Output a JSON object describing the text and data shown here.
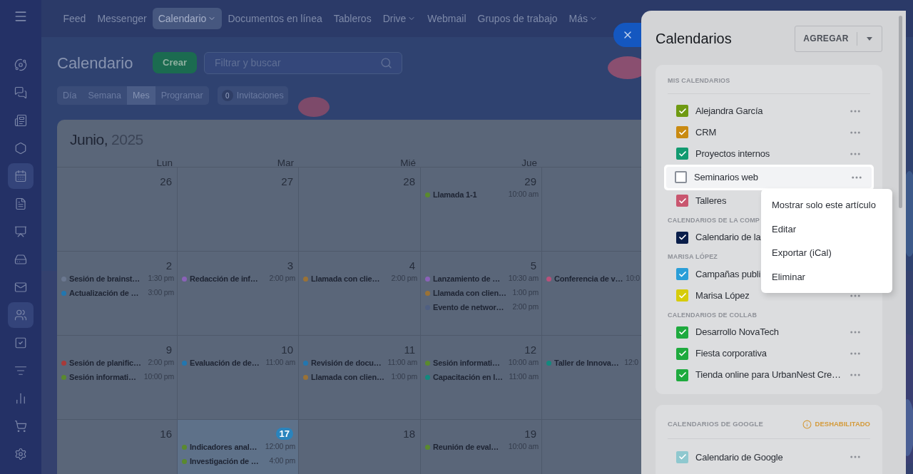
{
  "sidebar": {
    "items": [
      {
        "selected": false
      },
      {
        "selected": false
      },
      {
        "selected": false
      },
      {
        "selected": false
      },
      {
        "selected": true
      },
      {
        "selected": false
      },
      {
        "selected": false
      },
      {
        "selected": false
      },
      {
        "selected": false
      },
      {
        "selected": true
      },
      {
        "selected": false
      },
      {
        "selected": false
      },
      {
        "selected": false
      },
      {
        "selected": false
      },
      {
        "selected": false
      }
    ]
  },
  "top_nav": [
    {
      "label": "Feed",
      "selected": false,
      "dropdown": false
    },
    {
      "label": "Messenger",
      "selected": false,
      "dropdown": false
    },
    {
      "label": "Calendario",
      "selected": true,
      "dropdown": true
    },
    {
      "label": "Documentos en línea",
      "selected": false,
      "dropdown": false
    },
    {
      "label": "Tableros",
      "selected": false,
      "dropdown": false
    },
    {
      "label": "Drive",
      "selected": false,
      "dropdown": true
    },
    {
      "label": "Webmail",
      "selected": false,
      "dropdown": false
    },
    {
      "label": "Grupos de trabajo",
      "selected": false,
      "dropdown": false
    },
    {
      "label": "Más",
      "selected": false,
      "dropdown": true
    }
  ],
  "page_title": "Calendario",
  "create_button": "Crear",
  "search": {
    "placeholder": "Filtrar y buscar"
  },
  "view_tabs": [
    {
      "label": "Día",
      "selected": false
    },
    {
      "label": "Semana",
      "selected": false
    },
    {
      "label": "Mes",
      "selected": true
    },
    {
      "label": "Programar",
      "selected": false
    }
  ],
  "invitations": {
    "count": "0",
    "label": "Invitaciones"
  },
  "calendar": {
    "month": "Junio,",
    "year": "2025",
    "weekdays": [
      "Lun",
      "Mar",
      "Mié",
      "Jue"
    ],
    "weeks": [
      [
        {
          "day": "26",
          "today": false
        },
        {
          "day": "27",
          "today": false
        },
        {
          "day": "28",
          "today": false
        },
        {
          "day": "29",
          "today": false,
          "events": [
            {
              "title": "Llamada 1-1",
              "time": "10:00 am",
              "color": "#5a8a2e"
            }
          ]
        }
      ],
      [
        {
          "day": "2",
          "today": false,
          "events": [
            {
              "title": "Sesión de brainst…",
              "time": "1:30 pm",
              "color": "#6b7890"
            },
            {
              "title": "Actualización de …",
              "time": "3:00 pm",
              "color": "#2277b0"
            }
          ]
        },
        {
          "day": "3",
          "today": false,
          "events": [
            {
              "title": "Redacción de inf…",
              "time": "2:00 pm",
              "color": "#8a62b8"
            }
          ]
        },
        {
          "day": "4",
          "today": false,
          "events": [
            {
              "title": "Llamada con clie…",
              "time": "2:00 pm",
              "color": "#9a7236"
            }
          ]
        },
        {
          "day": "5",
          "today": false,
          "events": [
            {
              "title": "Lanzamiento de …",
              "time": "10:30 am",
              "color": "#8a62b8"
            },
            {
              "title": "Llamada con clien…",
              "time": "1:00 pm",
              "color": "#9a7236"
            },
            {
              "title": "Evento de networ…",
              "time": "2:00 pm",
              "color": "#4f5f82"
            }
          ]
        },
        {
          "today": false,
          "events": [
            {
              "title": "Conferencia de v…",
              "time": "10:0",
              "color": "#b8517a"
            }
          ]
        }
      ],
      [
        {
          "day": "9",
          "today": false,
          "events": [
            {
              "title": "Sesión de planific…",
              "time": "2:00 pm",
              "color": "#a83a3a"
            },
            {
              "title": "Sesión informati…",
              "time": "10:00 pm",
              "color": "#5a8a2e"
            }
          ]
        },
        {
          "day": "10",
          "today": false,
          "events": [
            {
              "title": "Evaluación de de…",
              "time": "11:00 am",
              "color": "#2277b0"
            }
          ]
        },
        {
          "day": "11",
          "today": false,
          "events": [
            {
              "title": "Revisión de docu…",
              "time": "11:00 am",
              "color": "#2277b0"
            },
            {
              "title": "Llamada con clien…",
              "time": "1:00 pm",
              "color": "#9a7236"
            }
          ]
        },
        {
          "day": "12",
          "today": false,
          "events": [
            {
              "title": "Sesión informati…",
              "time": "10:00 am",
              "color": "#5a8a2e"
            },
            {
              "title": "Capacitación en l…",
              "time": "11:00 am",
              "color": "#13897e"
            }
          ]
        },
        {
          "today": false,
          "events": [
            {
              "title": "Taller de Innova…",
              "time": "12:0",
              "color": "#13897e"
            }
          ]
        }
      ],
      [
        {
          "day": "16",
          "today": false
        },
        {
          "day": "17",
          "today": true,
          "events": [
            {
              "title": "Indicadores anal…",
              "time": "12:00 pm",
              "color": "#5a8a2e"
            },
            {
              "title": "Investigación de …",
              "time": "4:00 pm",
              "color": "#5a8a2e"
            }
          ]
        },
        {
          "day": "18",
          "today": false
        },
        {
          "day": "19",
          "today": false,
          "events": [
            {
              "title": "Reunión de eval…",
              "time": "10:00 am",
              "color": "#5a8a2e"
            }
          ]
        }
      ]
    ]
  },
  "panel": {
    "title": "Calendarios",
    "add_button": "AGREGAR",
    "sections": [
      {
        "heading": "MIS CALENDARIOS",
        "items": [
          {
            "label": "Alejandra García",
            "color": "#6f9a12",
            "checked": true,
            "highlighted": false,
            "more_button": true
          },
          {
            "label": "CRM",
            "color": "#c98a12",
            "checked": true,
            "highlighted": false,
            "more_button": true
          },
          {
            "label": "Proyectos internos",
            "color": "#129a70",
            "checked": true,
            "highlighted": false,
            "more_button": true
          },
          {
            "label": "Seminarios web",
            "color": "#8a8f99",
            "checked": false,
            "highlighted": true,
            "more_button": true
          },
          {
            "label": "Talleres",
            "color": "#c9566f",
            "checked": true,
            "highlighted": false
          }
        ]
      },
      {
        "heading": "CALENDARIOS DE LA COMP",
        "items": [
          {
            "label": "Calendario de la",
            "color": "#0a1e4a",
            "checked": true,
            "highlighted": false
          }
        ]
      },
      {
        "heading": "MARISA LÓPEZ",
        "items": [
          {
            "label": "Campañas publi",
            "color": "#2a9ed8",
            "checked": true,
            "highlighted": false
          },
          {
            "label": "Marisa López",
            "color": "#d6cc0a",
            "checked": true,
            "highlighted": false,
            "more_button": true
          }
        ]
      },
      {
        "heading": "CALENDARIOS DE COLLAB",
        "items": [
          {
            "label": "Desarrollo NovaTech",
            "color": "#1eaa3e",
            "checked": true,
            "highlighted": false,
            "more_button": true
          },
          {
            "label": "Fiesta corporativa",
            "color": "#1eaa3e",
            "checked": true,
            "highlighted": false,
            "more_button": true
          },
          {
            "label": "Tienda online para UrbanNest Cre…",
            "color": "#1eaa3e",
            "checked": true,
            "highlighted": false,
            "more_button": true
          }
        ]
      }
    ],
    "google": {
      "heading": "CALENDARIOS DE GOOGLE",
      "status": "DESHABILITADO",
      "items": [
        {
          "label": "Calendario de Google",
          "color": "#8fc8cf",
          "checked": true,
          "more_button": true
        }
      ]
    }
  },
  "context_menu": [
    "Mostrar solo este artículo",
    "Editar",
    "Exportar (iCal)",
    "Eliminar"
  ]
}
